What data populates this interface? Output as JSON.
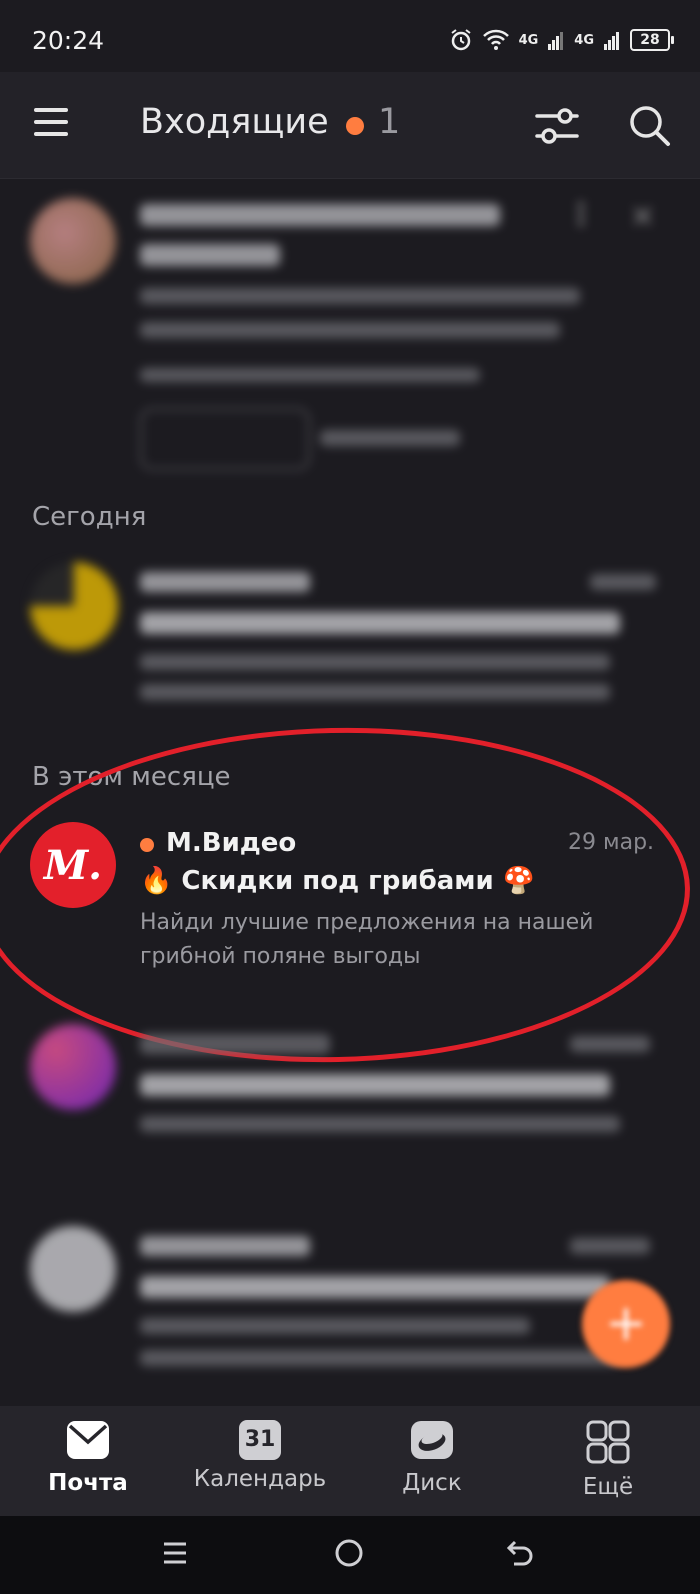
{
  "status_bar": {
    "time": "20:24",
    "signal_1": "4G",
    "signal_2": "4G",
    "battery": "28"
  },
  "header": {
    "title": "Входящие",
    "unread_count": "1"
  },
  "sections": {
    "today": "Сегодня",
    "this_month": "В этом месяце"
  },
  "featured_email": {
    "sender": "М.Видео",
    "date": "29 мар.",
    "subject": "🔥 Скидки под грибами 🍄",
    "preview_line1": "Найди лучшие предложения на нашей",
    "preview_line2": "грибной поляне выгоды",
    "avatar_letter": "М.",
    "brand_color": "#e3202b"
  },
  "bottom_nav": [
    {
      "label": "Почта",
      "icon": "mail-icon"
    },
    {
      "label": "Календарь",
      "icon": "calendar-icon",
      "badge": "31"
    },
    {
      "label": "Диск",
      "icon": "disk-icon"
    },
    {
      "label": "Ещё",
      "icon": "more-apps-icon"
    }
  ],
  "colors": {
    "accent": "#ff7d40",
    "background": "#1c1b20",
    "highlight_circle": "#e2202a"
  }
}
